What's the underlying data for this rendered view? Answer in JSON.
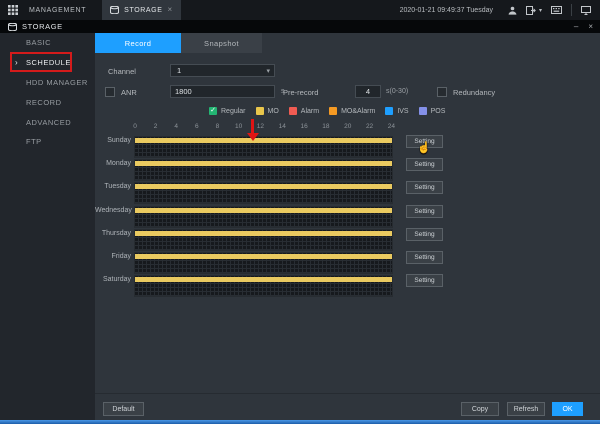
{
  "topbar": {
    "menu_label": "MANAGEMENT",
    "active_tab": "STORAGE",
    "tab_close": "×",
    "datetime": "2020-01-21 09:49:37 Tuesday"
  },
  "titlebar": {
    "title": "STORAGE",
    "minimize": "–",
    "close": "×"
  },
  "sidebar": {
    "items": [
      {
        "label": "BASIC",
        "active": false,
        "arrow": ""
      },
      {
        "label": "SCHEDULE",
        "active": true,
        "arrow": "›"
      },
      {
        "label": "HDD MANAGER",
        "active": false,
        "arrow": ""
      },
      {
        "label": "RECORD",
        "active": false,
        "arrow": ""
      },
      {
        "label": "ADVANCED",
        "active": false,
        "arrow": ""
      },
      {
        "label": "FTP",
        "active": false,
        "arrow": ""
      }
    ]
  },
  "main": {
    "tabs": [
      {
        "label": "Record",
        "active": true
      },
      {
        "label": "Snapshot",
        "active": false
      }
    ],
    "channel": {
      "label": "Channel",
      "value": "1",
      "chevron": "▾"
    },
    "anr": {
      "label": "ANR",
      "value": "1800",
      "unit": "s",
      "checked": false
    },
    "pre_record": {
      "label": "Pre-record",
      "value": "4",
      "unit": "s(0-30)"
    },
    "redundancy": {
      "label": "Redundancy",
      "checked": false
    },
    "legend": [
      {
        "label": "Regular",
        "color": "#23b573",
        "check": "✓"
      },
      {
        "label": "MO",
        "color": "#e9c64b",
        "check": ""
      },
      {
        "label": "Alarm",
        "color": "#f05b52",
        "check": ""
      },
      {
        "label": "MO&Alarm",
        "color": "#f59a23",
        "check": ""
      },
      {
        "label": "IVS",
        "color": "#1e9fff",
        "check": ""
      },
      {
        "label": "POS",
        "color": "#8490e8",
        "check": ""
      }
    ],
    "timeline_hours": [
      "0",
      "2",
      "4",
      "6",
      "8",
      "10",
      "12",
      "14",
      "16",
      "18",
      "20",
      "22",
      "24"
    ],
    "schedule": {
      "bar_color": "#eaca60",
      "bar_type": "MO",
      "hours_total": 24
    },
    "days": [
      {
        "label": "Sunday",
        "setting_label": "Setting",
        "bar": {
          "start": 0,
          "end": 24
        }
      },
      {
        "label": "Monday",
        "setting_label": "Setting",
        "bar": {
          "start": 0,
          "end": 24
        }
      },
      {
        "label": "Tuesday",
        "setting_label": "Setting",
        "bar": {
          "start": 0,
          "end": 24
        }
      },
      {
        "label": "Wednesday",
        "setting_label": "Setting",
        "bar": {
          "start": 0,
          "end": 24
        }
      },
      {
        "label": "Thursday",
        "setting_label": "Setting",
        "bar": {
          "start": 0,
          "end": 24
        }
      },
      {
        "label": "Friday",
        "setting_label": "Setting",
        "bar": {
          "start": 0,
          "end": 24
        }
      },
      {
        "label": "Saturday",
        "setting_label": "Setting",
        "bar": {
          "start": 0,
          "end": 24
        }
      }
    ],
    "footer": {
      "default_label": "Default",
      "copy_label": "Copy",
      "refresh_label": "Refresh",
      "ok_label": "OK"
    }
  },
  "annotations": {
    "highlighted_sidebar_item": "SCHEDULE",
    "arrow_hour": 11,
    "arrow_color": "#e01414",
    "cursor_glyph": "☝"
  },
  "colors": {
    "accent_blue": "#1e9fff",
    "annotation_red": "#d41b1b",
    "bar_yellow": "#eaca60"
  }
}
